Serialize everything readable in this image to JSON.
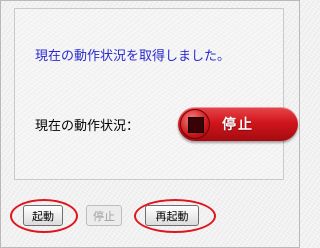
{
  "status": {
    "message": "現在の動作状況を取得しました。",
    "label": "現在の動作状況：",
    "indicator_text": "停止",
    "indicator_color": "#d1161c"
  },
  "buttons": {
    "start": "起動",
    "stop": "停止",
    "restart": "再起動"
  },
  "colors": {
    "message_text": "#2a2ad0",
    "highlight": "#e0141c"
  }
}
